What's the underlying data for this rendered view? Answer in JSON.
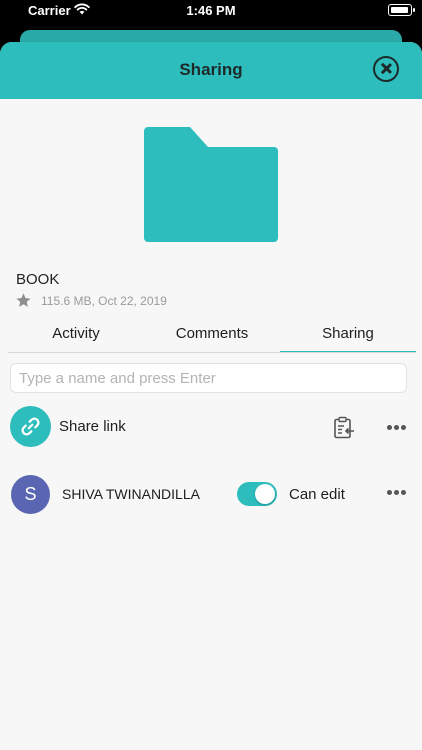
{
  "status_bar": {
    "carrier": "Carrier",
    "time": "1:46 PM"
  },
  "header": {
    "title": "Sharing"
  },
  "file": {
    "name": "BOOK",
    "meta": "115.6 MB, Oct 22, 2019"
  },
  "tabs": [
    {
      "label": "Activity",
      "active": false
    },
    {
      "label": "Comments",
      "active": false
    },
    {
      "label": "Sharing",
      "active": true
    }
  ],
  "search": {
    "placeholder": "Type a name and press Enter",
    "value": ""
  },
  "share_link": {
    "label": "Share link"
  },
  "user": {
    "initial": "S",
    "name": "SHIVA TWINANDILLA",
    "permission": "Can edit",
    "toggle_on": true
  },
  "colors": {
    "accent": "#2dbdbd",
    "avatar": "#5b66b2"
  },
  "icons": [
    "wifi-icon",
    "battery-icon",
    "close-icon",
    "folder-icon",
    "star-icon",
    "link-icon",
    "clipboard-icon",
    "more-icon"
  ]
}
